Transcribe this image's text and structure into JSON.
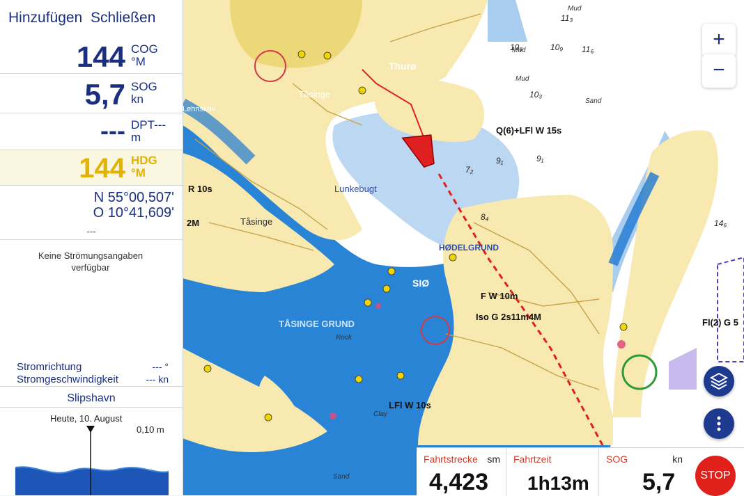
{
  "topbar": {
    "add_label": "Hinzufügen",
    "close_label": "Schließen"
  },
  "cog": {
    "value": "144",
    "label": "COG",
    "unit": "°M"
  },
  "sog": {
    "value": "5,7",
    "label": "SOG",
    "unit": "kn"
  },
  "dpt": {
    "value": "---",
    "label": "DPT",
    "label_suffix": "---",
    "unit": "m"
  },
  "hdg": {
    "value": "144",
    "label": "HDG",
    "unit": "°M"
  },
  "position": {
    "lat": "N 55°00,507'",
    "lon": "O 10°41,609'",
    "extra": "---"
  },
  "current": {
    "message": "Keine Strömungsangaben verfügbar",
    "direction_label": "Stromrichtung",
    "direction_value": "--- °",
    "speed_label": "Stromgeschwindigkeit",
    "speed_value": "--- kn"
  },
  "tide": {
    "station": "Slipshavn",
    "date": "Heute, 10. August",
    "height": "0,10 m"
  },
  "map": {
    "labels": {
      "thuro": "Thurø",
      "tasinge1": "Tåsinge",
      "tasinge2": "Tåsinge",
      "tasinge_caps": "TÅSINGE",
      "lunkebugt": "Lunkebugt",
      "tasinge_grund": "TÅSINGE GRUND",
      "hodelgrund": "HØDELGRUND",
      "sio": "SIØ",
      "lehnskov": "Lehnskov",
      "light1": "Q(6)+LFl W 15s",
      "light2": "F W 10m",
      "light3": "Iso G 2s11m4M",
      "light4": "LFl W 10s",
      "light5": "R 10s",
      "light6": "2M",
      "light7": "Fl(2) G 5",
      "mud1": "Mud",
      "mud2": "Mud",
      "mud3": "Mud",
      "sand1": "Sand",
      "sand2": "Sand",
      "rock1": "Rock",
      "clay1": "Clay",
      "depth1": "10₆",
      "depth2": "10₉",
      "depth3": "11₆",
      "depth4": "10₃",
      "depth5": "11₃",
      "depth6": "9₁",
      "depth7": "7₂",
      "depth8": "14₆",
      "depth9": "8₄",
      "depth10": "9₁"
    }
  },
  "controls": {
    "zoom_in": "+",
    "zoom_out": "−"
  },
  "trip": {
    "distance_label": "Fahrtstrecke",
    "distance_unit": "sm",
    "distance_value": "4,423",
    "time_label": "Fahrtzeit",
    "time_value": "1h13m",
    "sog_label": "SOG",
    "sog_unit": "kn",
    "sog_value": "5,7",
    "stop_label": "STOP"
  },
  "colors": {
    "accent": "#1a2f80",
    "land": "#f7e9b0",
    "deep_water": "#ffffff",
    "shallow": "#1f78d1",
    "track_red": "#e02020"
  }
}
